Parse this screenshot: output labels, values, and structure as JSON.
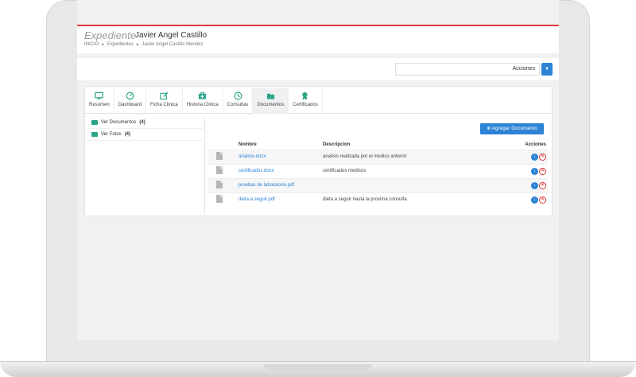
{
  "header": {
    "page_title": "Expediente",
    "patient_name": "Javier Angel Castillo",
    "breadcrumb": [
      "INICIO",
      "Expedientes",
      "Javier Angel Castillo Mendez"
    ]
  },
  "actions": {
    "label": "Acciones"
  },
  "tabs": [
    {
      "label": "Resumen",
      "icon": "monitor-icon"
    },
    {
      "label": "Dashboard",
      "icon": "gauge-icon"
    },
    {
      "label": "Ficha Clínica",
      "icon": "edit-icon"
    },
    {
      "label": "Historia Clinica",
      "icon": "medical-kit-icon"
    },
    {
      "label": "Consultas",
      "icon": "clock-icon"
    },
    {
      "label": "Documentos",
      "icon": "folder-icon"
    },
    {
      "label": "Certificados",
      "icon": "award-icon"
    }
  ],
  "sidebar": {
    "items": [
      {
        "label": "Ver Documentos",
        "count": "(4)"
      },
      {
        "label": "Ver Fotos",
        "count": "(4)"
      }
    ]
  },
  "docs": {
    "add_button": "Agregar Documento",
    "columns": [
      "Nombre",
      "Descripcion",
      "Acciones"
    ],
    "rows": [
      {
        "name": "analisis.docx",
        "desc": "analisis realizada por el medico anterior"
      },
      {
        "name": "certificados.docx",
        "desc": "certificados medicos"
      },
      {
        "name": "pruebas de laboratorio.pdf",
        "desc": ""
      },
      {
        "name": "dieta a seguir.pdf",
        "desc": "dieta a seguir hasta la proxima consulta"
      }
    ]
  },
  "colors": {
    "accent": "#2d83d6",
    "brand_red": "#e1393a",
    "tab_icon": "#2aa587"
  }
}
